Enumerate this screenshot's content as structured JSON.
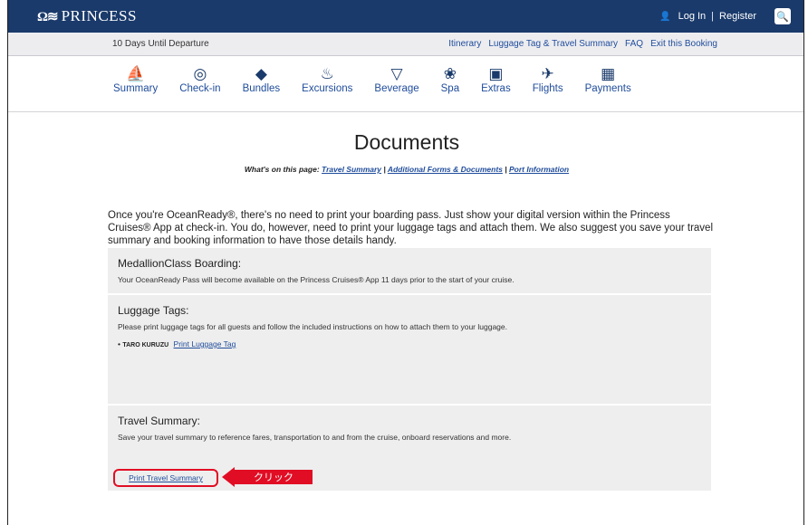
{
  "header": {
    "brand": "PRINCESS",
    "login": "Log In",
    "separator": "|",
    "register": "Register"
  },
  "subheader": {
    "countdown": "10 Days Until Departure",
    "links": [
      "Itinerary",
      "Luggage Tag & Travel Summary",
      "FAQ",
      "Exit this Booking"
    ]
  },
  "nav": {
    "items": [
      {
        "label": "Summary",
        "icon": "ship-icon"
      },
      {
        "label": "Check-in",
        "icon": "passport-icon"
      },
      {
        "label": "Bundles",
        "icon": "tag-icon"
      },
      {
        "label": "Excursions",
        "icon": "island-icon"
      },
      {
        "label": "Beverage",
        "icon": "wine-glass-icon"
      },
      {
        "label": "Spa",
        "icon": "lotus-icon"
      },
      {
        "label": "Extras",
        "icon": "star-box-icon"
      },
      {
        "label": "Flights",
        "icon": "plane-icon"
      },
      {
        "label": "Payments",
        "icon": "wallet-icon"
      }
    ]
  },
  "page": {
    "title": "Documents",
    "onpage_label": "What's on this page:",
    "onpage_links": [
      "Travel Summary",
      "Additional Forms & Documents",
      "Port Information"
    ],
    "intro": "Once you're OceanReady®, there's no need to print your boarding pass. Just show your digital version within the Princess Cruises® App at check-in. You do, however, need to print your luggage tags and attach them. We also suggest you save your travel summary and booking information to have those details handy."
  },
  "sections": {
    "medallion": {
      "title": "MedallionClass Boarding:",
      "text": "Your OceanReady Pass will become available on the Princess Cruises® App 11 days prior to the start of your cruise."
    },
    "luggage": {
      "title": "Luggage Tags:",
      "text": "Please print luggage tags for all guests and follow the included instructions on how to attach them to your luggage.",
      "guest_name": "TARO KURUZU",
      "link": "Print Luggage Tag"
    },
    "travel": {
      "title": "Travel Summary:",
      "text": "Save your travel summary to reference fares, transportation to and from the cruise, onboard reservations and more.",
      "link": "Print Travel Summary"
    }
  },
  "annotation": {
    "callout": "クリック",
    "color": "#e10d24"
  }
}
